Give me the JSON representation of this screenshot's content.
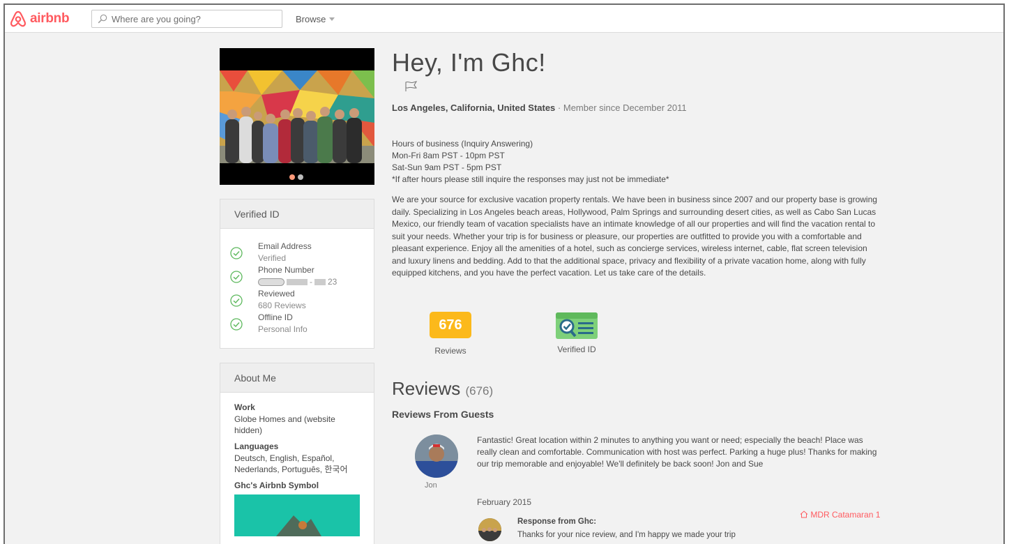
{
  "header": {
    "brand": "airbnb",
    "search_placeholder": "Where are you going?",
    "browse_label": "Browse"
  },
  "photo": {
    "dot_count": 2,
    "active_dot": 1
  },
  "verified_panel": {
    "title": "Verified ID",
    "items": [
      {
        "label": "Email Address",
        "status": "Verified"
      },
      {
        "label": "Phone Number",
        "status": "23"
      },
      {
        "label": "Reviewed",
        "status": "680 Reviews"
      },
      {
        "label": "Offline ID",
        "status": "Personal Info"
      }
    ]
  },
  "about_panel": {
    "title": "About Me",
    "work_heading": "Work",
    "work_text": "Globe Homes and (website hidden)",
    "languages_heading": "Languages",
    "languages_text": "Deutsch, English, Español, Nederlands, Português, 한국어",
    "symbol_heading": "Ghc's Airbnb Symbol"
  },
  "profile": {
    "title": "Hey, I'm Ghc!",
    "location": "Los Angeles, California, United States",
    "separator": " · ",
    "member_since": "Member since December 2011",
    "hours": [
      "Hours of business (Inquiry Answering)",
      "Mon-Fri 8am PST - 10pm PST",
      "Sat-Sun 9am PST - 5pm PST",
      "*If after hours please still inquire the responses may just not be immediate*"
    ],
    "description": "We are your source for exclusive vacation property rentals. We have been in business since 2007 and our property base is growing daily. Specializing in Los Angeles beach areas, Hollywood, Palm Springs and surrounding desert cities, as well as Cabo San Lucas Mexico, our friendly team of vacation specialists have an intimate knowledge of all our properties and will find the vacation rental to suit your needs. Whether your trip is for business or pleasure, our properties are outfitted to provide you with a comfortable and pleasant experience. Enjoy all the amenities of a hotel, such as concierge services, wireless internet, cable, flat screen television and luxury linens and bedding. Add to that the additional space, privacy and flexibility of a private vacation home, along with fully equipped kitchens, and you have the perfect vacation. Let us take care of the details."
  },
  "badges": {
    "reviews_count": "676",
    "reviews_label": "Reviews",
    "verified_label": "Verified ID"
  },
  "reviews": {
    "heading": "Reviews",
    "count": "(676)",
    "subheading": "Reviews From Guests",
    "items": [
      {
        "name": "Jon",
        "text": "Fantastic! Great location within 2 minutes to anything you want or need; especially the beach! Place was really clean and comfortable. Communication with host was perfect. Parking a huge plus! Thanks for making our trip memorable and enjoyable! We'll definitely be back soon! Jon and Sue",
        "date": "February 2015",
        "listing": "MDR Catamaran 1",
        "response_heading": "Response from Ghc:",
        "response_text": "Thanks for your nice review, and I'm happy we made your trip"
      }
    ]
  },
  "colors": {
    "brand": "#ff5a5f",
    "badge_orange": "#fcb91b",
    "verified_green": "#5cb85c",
    "page_bg": "#f2f2f2"
  }
}
